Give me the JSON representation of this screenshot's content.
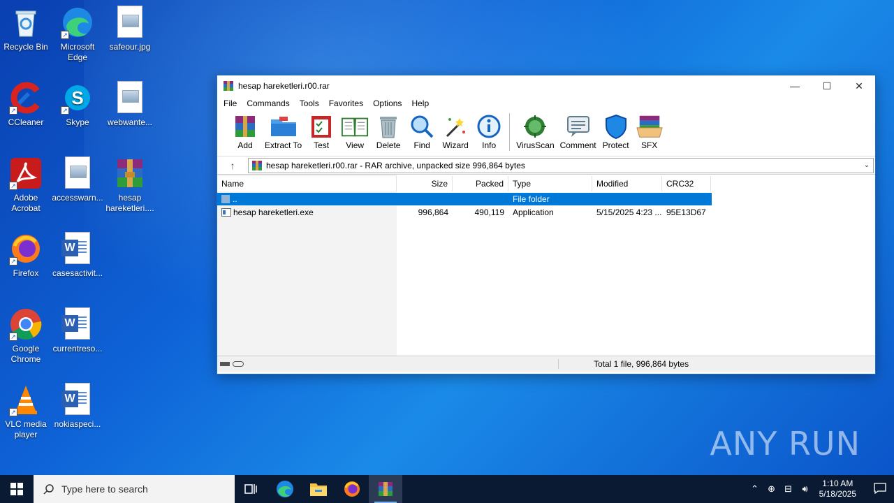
{
  "desktop": {
    "icons": [
      {
        "label": "Recycle Bin"
      },
      {
        "label": "Microsoft Edge"
      },
      {
        "label": "safeour.jpg"
      },
      {
        "label": "CCleaner"
      },
      {
        "label": "Skype"
      },
      {
        "label": "webwante..."
      },
      {
        "label": "Adobe Acrobat"
      },
      {
        "label": "accesswarn..."
      },
      {
        "label": "hesap hareketleri...."
      },
      {
        "label": "Firefox"
      },
      {
        "label": "casesactivit..."
      },
      {
        "label": "Google Chrome"
      },
      {
        "label": "currentreso..."
      },
      {
        "label": "VLC media player"
      },
      {
        "label": "nokiaspeci..."
      }
    ],
    "watermark": "ANY RUN"
  },
  "window": {
    "title": "hesap hareketleri.r00.rar",
    "controls": {
      "minimize": "—",
      "maximize": "☐",
      "close": "✕"
    },
    "menu": [
      "File",
      "Commands",
      "Tools",
      "Favorites",
      "Options",
      "Help"
    ],
    "toolbar": [
      {
        "label": "Add",
        "icon": "add-icon"
      },
      {
        "label": "Extract To",
        "icon": "extract-to-icon"
      },
      {
        "label": "Test",
        "icon": "test-icon"
      },
      {
        "label": "View",
        "icon": "view-icon"
      },
      {
        "label": "Delete",
        "icon": "delete-icon"
      },
      {
        "label": "Find",
        "icon": "find-icon"
      },
      {
        "label": "Wizard",
        "icon": "wizard-icon"
      },
      {
        "label": "Info",
        "icon": "info-icon"
      },
      {
        "label": "VirusScan",
        "icon": "virusscan-icon"
      },
      {
        "label": "Comment",
        "icon": "comment-icon"
      },
      {
        "label": "Protect",
        "icon": "protect-icon"
      },
      {
        "label": "SFX",
        "icon": "sfx-icon"
      }
    ],
    "address": "hesap hareketleri.r00.rar - RAR archive, unpacked size 996,864 bytes",
    "columns": [
      "Name",
      "Size",
      "Packed",
      "Type",
      "Modified",
      "CRC32"
    ],
    "rows": [
      {
        "name": "..",
        "size": "",
        "packed": "",
        "type": "File folder",
        "modified": "",
        "crc": ""
      },
      {
        "name": "hesap hareketleri.exe",
        "size": "996,864",
        "packed": "490,119",
        "type": "Application",
        "modified": "5/15/2025 4:23 ...",
        "crc": "95E13D67"
      }
    ],
    "status": "Total 1 file, 996,864 bytes"
  },
  "taskbar": {
    "search_placeholder": "Type here to search",
    "time": "1:10 AM",
    "date": "5/18/2025"
  }
}
